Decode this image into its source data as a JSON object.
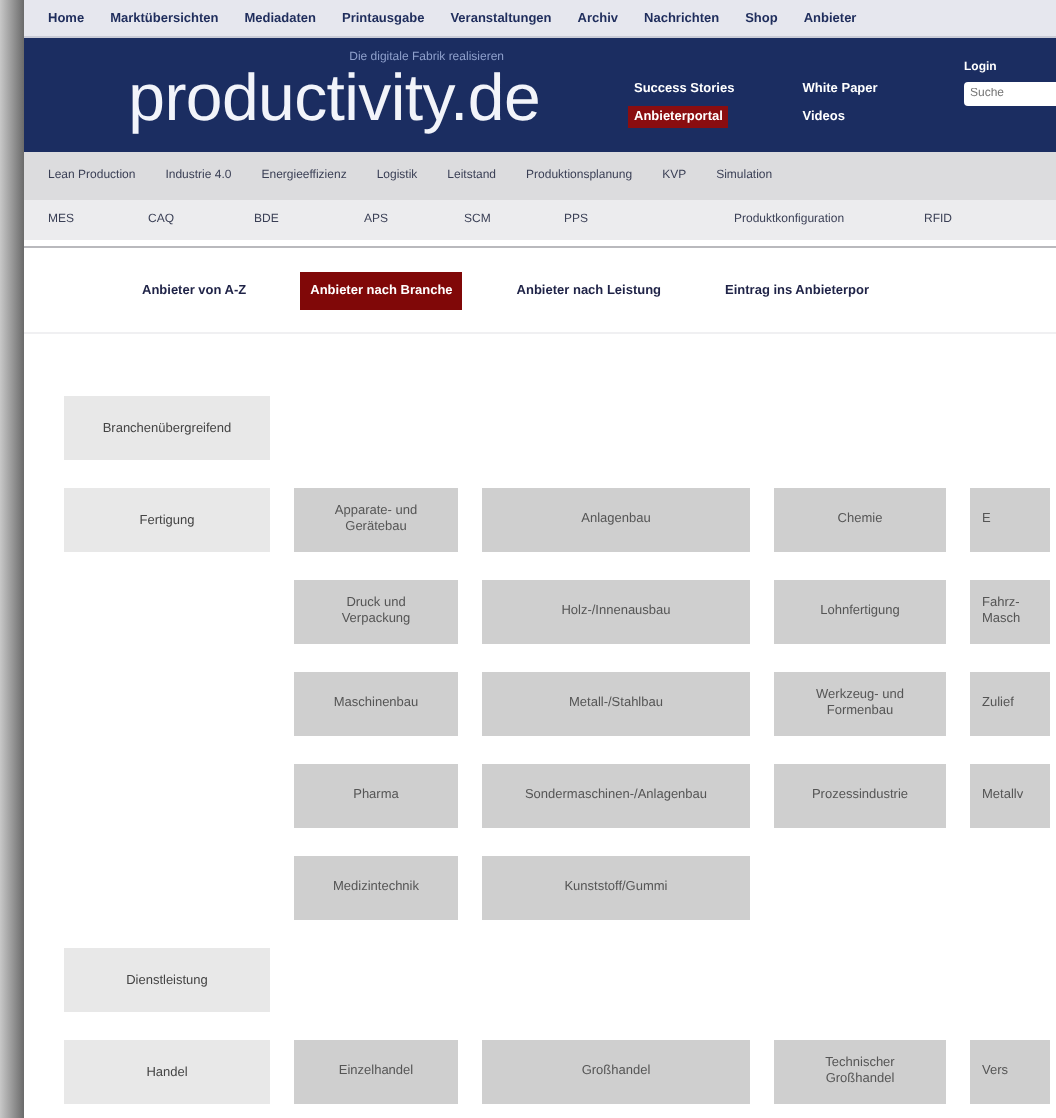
{
  "top_nav": [
    "Home",
    "Marktübersichten",
    "Mediadaten",
    "Printausgabe",
    "Veranstaltungen",
    "Archiv",
    "Nachrichten",
    "Shop",
    "Anbieter"
  ],
  "header": {
    "tagline": "Die digitale Fabrik realisieren",
    "logo": "productivity.de",
    "links": [
      {
        "label": "Success Stories",
        "highlighted": false
      },
      {
        "label": "Anbieterportal",
        "highlighted": true
      },
      {
        "label": "White Paper",
        "highlighted": false
      },
      {
        "label": "Videos",
        "highlighted": false
      }
    ],
    "login": "Login",
    "search": {
      "placeholder": "Suche"
    }
  },
  "topic_nav": [
    "Lean Production",
    "Industrie 4.0",
    "Energieeffizienz",
    "Logistik",
    "Leitstand",
    "Produktionsplanung",
    "KVP",
    "Simulation"
  ],
  "tech_nav": [
    "MES",
    "CAQ",
    "BDE",
    "APS",
    "SCM",
    "PPS",
    "Produktkonfiguration",
    "RFID"
  ],
  "tabs": [
    {
      "label": "Anbieter von A-Z",
      "selected": false
    },
    {
      "label": "Anbieter nach Branche",
      "selected": true
    },
    {
      "label": "Anbieter nach Leistung",
      "selected": false
    },
    {
      "label": "Eintrag ins Anbieterpor",
      "selected": false
    }
  ],
  "categories": [
    {
      "label": "Branchenübergreifend"
    },
    {
      "label": "Fertigung",
      "items": [
        "Apparate- und Gerätebau",
        "Anlagenbau",
        "Chemie",
        "E",
        "Druck und Verpackung",
        "Holz-/Innenausbau",
        "Lohnfertigung",
        "Fahrz- Masch",
        "Maschinenbau",
        "Metall-/Stahlbau",
        "Werkzeug- und Formenbau",
        "Zulief",
        "Pharma",
        "Sondermaschinen-/Anlagenbau",
        "Prozessindustrie",
        "Metallv",
        "Medizintechnik",
        "Kunststoff/Gummi"
      ]
    },
    {
      "label": "Dienstleistung"
    },
    {
      "label": "Handel",
      "items": [
        "Einzelhandel",
        "Großhandel",
        "Technischer Großhandel",
        "Vers"
      ]
    }
  ]
}
